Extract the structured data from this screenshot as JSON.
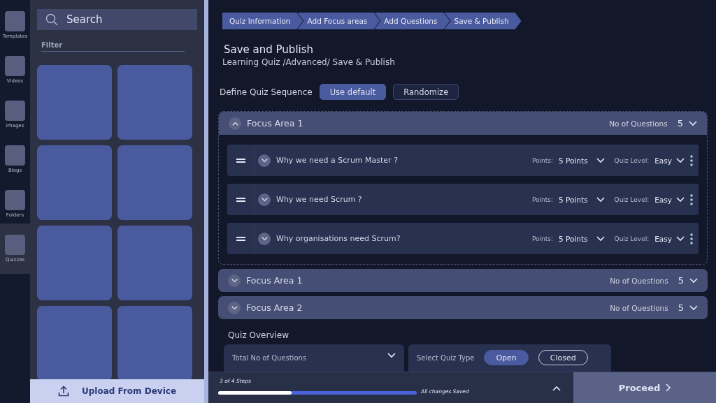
{
  "rail": {
    "items": [
      {
        "label": "Templates",
        "selected": false
      },
      {
        "label": "Videos",
        "selected": false
      },
      {
        "label": "Images",
        "selected": false
      },
      {
        "label": "Blogs",
        "selected": false
      },
      {
        "label": "Folders",
        "selected": false
      },
      {
        "label": "Quizzes",
        "selected": true
      }
    ]
  },
  "library": {
    "search": {
      "placeholder": "Search"
    },
    "filter": "Filter",
    "upload": "Upload From Device"
  },
  "steps": [
    {
      "label": "Quiz Information"
    },
    {
      "label": "Add Focus areas"
    },
    {
      "label": "Add Questions"
    },
    {
      "label": "Save & Publish"
    }
  ],
  "title": "Save and Publish",
  "breadcrumb": "Learning Quiz /Advanced/ Save & Publish",
  "sequence": {
    "label": "Define Quiz Sequence",
    "options": [
      {
        "label": "Use default",
        "selected": true
      },
      {
        "label": "Randomize",
        "selected": false
      }
    ]
  },
  "focus_areas": [
    {
      "name": "Focus Area 1",
      "count_label": "No of Questions",
      "count": "5",
      "expanded": true,
      "questions": [
        {
          "text": "Why we need a Scrum Master ?",
          "points_label": "Points:",
          "points": "5 Points",
          "level_label": "Quiz Level:",
          "level_value": "Easy"
        },
        {
          "text": "Why we need Scrum ?",
          "points_label": "Points:",
          "points": "5 Points",
          "level_label": "Quiz Level:",
          "level_value": "Easy"
        },
        {
          "text": "Why organisations need Scrum?",
          "points_label": "Points:",
          "points": "5 Points",
          "level_label": "Quiz Level:",
          "level_value": "Easy"
        }
      ]
    },
    {
      "name": "Focus Area 1",
      "count_label": "No of Questions",
      "count": "5",
      "expanded": false
    },
    {
      "name": "Focus Area 2",
      "count_label": "No of Questions",
      "count": "5",
      "expanded": false
    }
  ],
  "overview": {
    "title": "Quiz Overview",
    "total_label": "Total No of Questions",
    "type_label": "Select Quiz Type",
    "types": [
      {
        "label": "Open",
        "selected": true
      },
      {
        "label": "Closed",
        "selected": false
      }
    ]
  },
  "footer": {
    "steps": "3 of 4 Steps",
    "progress": {
      "level": 0.37
    },
    "saved": "All changes Saved",
    "proceed": "Proceed"
  }
}
